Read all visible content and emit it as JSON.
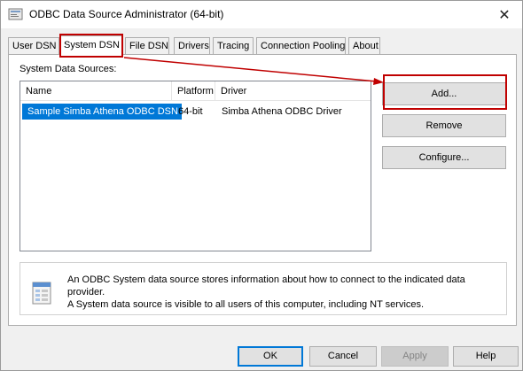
{
  "window": {
    "title": "ODBC Data Source Administrator (64-bit)"
  },
  "tabs": [
    {
      "label": "User DSN"
    },
    {
      "label": "System DSN"
    },
    {
      "label": "File DSN"
    },
    {
      "label": "Drivers"
    },
    {
      "label": "Tracing"
    },
    {
      "label": "Connection Pooling"
    },
    {
      "label": "About"
    }
  ],
  "active_tab": "System DSN",
  "panel": {
    "section_label": "System Data Sources:",
    "columns": [
      "Name",
      "Platform",
      "Driver"
    ],
    "rows": [
      {
        "name": "Sample Simba Athena ODBC DSN",
        "platform": "64-bit",
        "driver": "Simba Athena ODBC Driver"
      }
    ],
    "buttons": {
      "add": "Add...",
      "remove": "Remove",
      "configure": "Configure..."
    },
    "info": {
      "line1": "An ODBC System data source stores information about how to connect to the indicated data provider.",
      "line2": "A System data source is visible to all users of this computer, including NT services."
    }
  },
  "footer": {
    "ok": "OK",
    "cancel": "Cancel",
    "apply": "Apply",
    "help": "Help"
  },
  "colors": {
    "selection": "#0078d7",
    "annotation": "#c00000"
  }
}
